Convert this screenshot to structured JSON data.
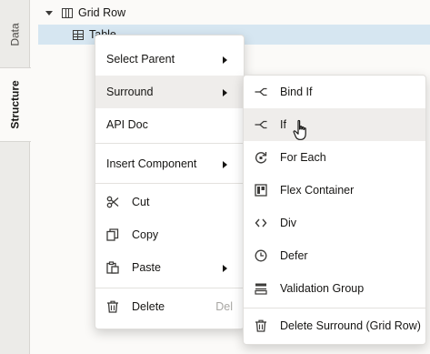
{
  "side_tabs": {
    "data": "Data",
    "structure": "Structure"
  },
  "tree": {
    "row1": "Grid Row",
    "row2": "Table"
  },
  "context_menu": {
    "items": [
      {
        "label": "Select Parent",
        "submenu": true
      },
      {
        "label": "Surround",
        "submenu": true,
        "highlighted": true
      },
      {
        "label": "API Doc"
      },
      {
        "label": "Insert Component",
        "submenu": true
      },
      {
        "label": "Cut",
        "icon": "scissors-icon"
      },
      {
        "label": "Copy",
        "icon": "copy-icon"
      },
      {
        "label": "Paste",
        "icon": "paste-icon",
        "submenu": true
      },
      {
        "label": "Delete",
        "icon": "trash-icon",
        "shortcut": "Del"
      }
    ]
  },
  "surround_submenu": {
    "items": [
      {
        "label": "Bind If",
        "icon": "branch-icon"
      },
      {
        "label": "If",
        "icon": "branch-icon",
        "highlighted": true
      },
      {
        "label": "For Each",
        "icon": "loop-icon"
      },
      {
        "label": "Flex Container",
        "icon": "flex-container-icon"
      },
      {
        "label": "Div",
        "icon": "code-brackets-icon"
      },
      {
        "label": "Defer",
        "icon": "clock-icon"
      },
      {
        "label": "Validation Group",
        "icon": "validation-group-icon"
      },
      {
        "label": "Delete Surround (Grid Row)",
        "icon": "trash-icon"
      }
    ]
  },
  "colors": {
    "selection": "#d6e6f1",
    "menu_highlight": "#efedeb",
    "side_strip": "#ecebe8"
  }
}
